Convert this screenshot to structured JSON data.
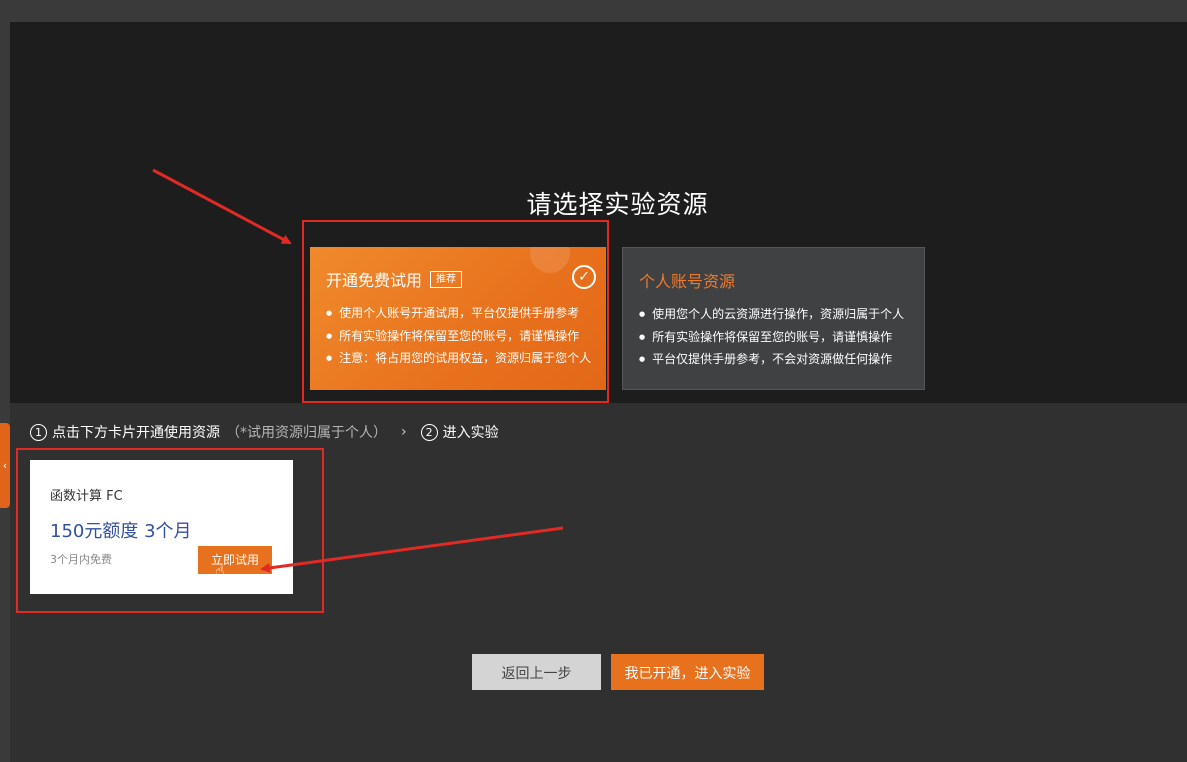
{
  "heading": "请选择实验资源",
  "free_trial_card": {
    "title": "开通免费试用",
    "badge": "推荐",
    "bullets": [
      "使用个人账号开通试用，平台仅提供手册参考",
      "所有实验操作将保留至您的账号，请谨慎操作",
      "注意：将占用您的试用权益，资源归属于您个人"
    ]
  },
  "personal_card": {
    "title": "个人账号资源",
    "bullets": [
      "使用您个人的云资源进行操作，资源归属于个人",
      "所有实验操作将保留至您的账号，请谨慎操作",
      "平台仅提供手册参考，不会对资源做任何操作"
    ]
  },
  "steps": {
    "step1_num": "1",
    "step1_text": "点击下方卡片开通使用资源",
    "step1_note": "（*试用资源归属于个人）",
    "separator": "›",
    "step2_num": "2",
    "step2_text": "进入实验"
  },
  "product_card": {
    "name": "函数计算 FC",
    "quota": "150元额度 3个月",
    "free_text": "3个月内免费",
    "try_button": "立即试用"
  },
  "buttons": {
    "back": "返回上一步",
    "enter": "我已开通，进入实验"
  },
  "side_tab_glyph": "‹",
  "colors": {
    "accent_orange": "#e8711d",
    "highlight_red": "#e22a25",
    "quota_blue": "#3451a1",
    "personal_title": "#ef7a2d"
  }
}
